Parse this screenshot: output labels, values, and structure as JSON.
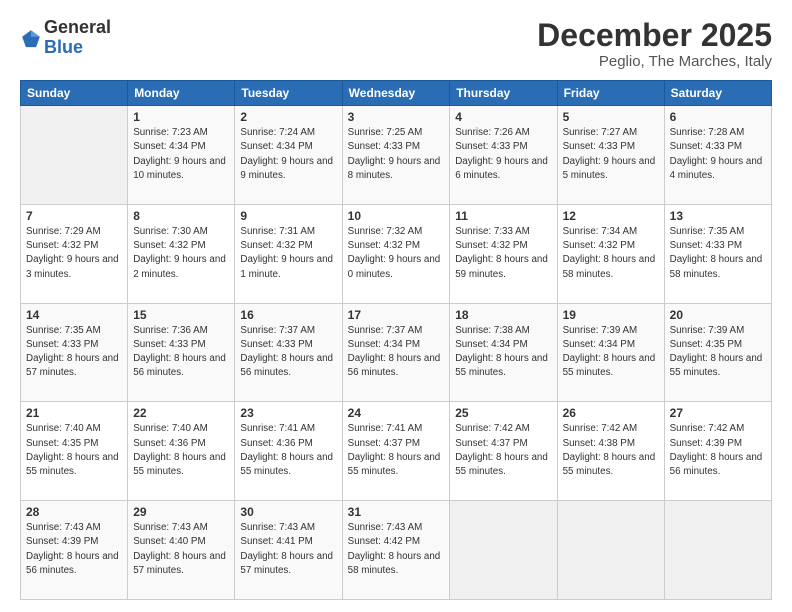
{
  "header": {
    "logo_general": "General",
    "logo_blue": "Blue",
    "month_title": "December 2025",
    "subtitle": "Peglio, The Marches, Italy"
  },
  "days_of_week": [
    "Sunday",
    "Monday",
    "Tuesday",
    "Wednesday",
    "Thursday",
    "Friday",
    "Saturday"
  ],
  "weeks": [
    [
      {
        "day": "",
        "sunrise": "",
        "sunset": "",
        "daylight": ""
      },
      {
        "day": "1",
        "sunrise": "Sunrise: 7:23 AM",
        "sunset": "Sunset: 4:34 PM",
        "daylight": "Daylight: 9 hours and 10 minutes."
      },
      {
        "day": "2",
        "sunrise": "Sunrise: 7:24 AM",
        "sunset": "Sunset: 4:34 PM",
        "daylight": "Daylight: 9 hours and 9 minutes."
      },
      {
        "day": "3",
        "sunrise": "Sunrise: 7:25 AM",
        "sunset": "Sunset: 4:33 PM",
        "daylight": "Daylight: 9 hours and 8 minutes."
      },
      {
        "day": "4",
        "sunrise": "Sunrise: 7:26 AM",
        "sunset": "Sunset: 4:33 PM",
        "daylight": "Daylight: 9 hours and 6 minutes."
      },
      {
        "day": "5",
        "sunrise": "Sunrise: 7:27 AM",
        "sunset": "Sunset: 4:33 PM",
        "daylight": "Daylight: 9 hours and 5 minutes."
      },
      {
        "day": "6",
        "sunrise": "Sunrise: 7:28 AM",
        "sunset": "Sunset: 4:33 PM",
        "daylight": "Daylight: 9 hours and 4 minutes."
      }
    ],
    [
      {
        "day": "7",
        "sunrise": "Sunrise: 7:29 AM",
        "sunset": "Sunset: 4:32 PM",
        "daylight": "Daylight: 9 hours and 3 minutes."
      },
      {
        "day": "8",
        "sunrise": "Sunrise: 7:30 AM",
        "sunset": "Sunset: 4:32 PM",
        "daylight": "Daylight: 9 hours and 2 minutes."
      },
      {
        "day": "9",
        "sunrise": "Sunrise: 7:31 AM",
        "sunset": "Sunset: 4:32 PM",
        "daylight": "Daylight: 9 hours and 1 minute."
      },
      {
        "day": "10",
        "sunrise": "Sunrise: 7:32 AM",
        "sunset": "Sunset: 4:32 PM",
        "daylight": "Daylight: 9 hours and 0 minutes."
      },
      {
        "day": "11",
        "sunrise": "Sunrise: 7:33 AM",
        "sunset": "Sunset: 4:32 PM",
        "daylight": "Daylight: 8 hours and 59 minutes."
      },
      {
        "day": "12",
        "sunrise": "Sunrise: 7:34 AM",
        "sunset": "Sunset: 4:32 PM",
        "daylight": "Daylight: 8 hours and 58 minutes."
      },
      {
        "day": "13",
        "sunrise": "Sunrise: 7:35 AM",
        "sunset": "Sunset: 4:33 PM",
        "daylight": "Daylight: 8 hours and 58 minutes."
      }
    ],
    [
      {
        "day": "14",
        "sunrise": "Sunrise: 7:35 AM",
        "sunset": "Sunset: 4:33 PM",
        "daylight": "Daylight: 8 hours and 57 minutes."
      },
      {
        "day": "15",
        "sunrise": "Sunrise: 7:36 AM",
        "sunset": "Sunset: 4:33 PM",
        "daylight": "Daylight: 8 hours and 56 minutes."
      },
      {
        "day": "16",
        "sunrise": "Sunrise: 7:37 AM",
        "sunset": "Sunset: 4:33 PM",
        "daylight": "Daylight: 8 hours and 56 minutes."
      },
      {
        "day": "17",
        "sunrise": "Sunrise: 7:37 AM",
        "sunset": "Sunset: 4:34 PM",
        "daylight": "Daylight: 8 hours and 56 minutes."
      },
      {
        "day": "18",
        "sunrise": "Sunrise: 7:38 AM",
        "sunset": "Sunset: 4:34 PM",
        "daylight": "Daylight: 8 hours and 55 minutes."
      },
      {
        "day": "19",
        "sunrise": "Sunrise: 7:39 AM",
        "sunset": "Sunset: 4:34 PM",
        "daylight": "Daylight: 8 hours and 55 minutes."
      },
      {
        "day": "20",
        "sunrise": "Sunrise: 7:39 AM",
        "sunset": "Sunset: 4:35 PM",
        "daylight": "Daylight: 8 hours and 55 minutes."
      }
    ],
    [
      {
        "day": "21",
        "sunrise": "Sunrise: 7:40 AM",
        "sunset": "Sunset: 4:35 PM",
        "daylight": "Daylight: 8 hours and 55 minutes."
      },
      {
        "day": "22",
        "sunrise": "Sunrise: 7:40 AM",
        "sunset": "Sunset: 4:36 PM",
        "daylight": "Daylight: 8 hours and 55 minutes."
      },
      {
        "day": "23",
        "sunrise": "Sunrise: 7:41 AM",
        "sunset": "Sunset: 4:36 PM",
        "daylight": "Daylight: 8 hours and 55 minutes."
      },
      {
        "day": "24",
        "sunrise": "Sunrise: 7:41 AM",
        "sunset": "Sunset: 4:37 PM",
        "daylight": "Daylight: 8 hours and 55 minutes."
      },
      {
        "day": "25",
        "sunrise": "Sunrise: 7:42 AM",
        "sunset": "Sunset: 4:37 PM",
        "daylight": "Daylight: 8 hours and 55 minutes."
      },
      {
        "day": "26",
        "sunrise": "Sunrise: 7:42 AM",
        "sunset": "Sunset: 4:38 PM",
        "daylight": "Daylight: 8 hours and 55 minutes."
      },
      {
        "day": "27",
        "sunrise": "Sunrise: 7:42 AM",
        "sunset": "Sunset: 4:39 PM",
        "daylight": "Daylight: 8 hours and 56 minutes."
      }
    ],
    [
      {
        "day": "28",
        "sunrise": "Sunrise: 7:43 AM",
        "sunset": "Sunset: 4:39 PM",
        "daylight": "Daylight: 8 hours and 56 minutes."
      },
      {
        "day": "29",
        "sunrise": "Sunrise: 7:43 AM",
        "sunset": "Sunset: 4:40 PM",
        "daylight": "Daylight: 8 hours and 57 minutes."
      },
      {
        "day": "30",
        "sunrise": "Sunrise: 7:43 AM",
        "sunset": "Sunset: 4:41 PM",
        "daylight": "Daylight: 8 hours and 57 minutes."
      },
      {
        "day": "31",
        "sunrise": "Sunrise: 7:43 AM",
        "sunset": "Sunset: 4:42 PM",
        "daylight": "Daylight: 8 hours and 58 minutes."
      },
      {
        "day": "",
        "sunrise": "",
        "sunset": "",
        "daylight": ""
      },
      {
        "day": "",
        "sunrise": "",
        "sunset": "",
        "daylight": ""
      },
      {
        "day": "",
        "sunrise": "",
        "sunset": "",
        "daylight": ""
      }
    ]
  ]
}
